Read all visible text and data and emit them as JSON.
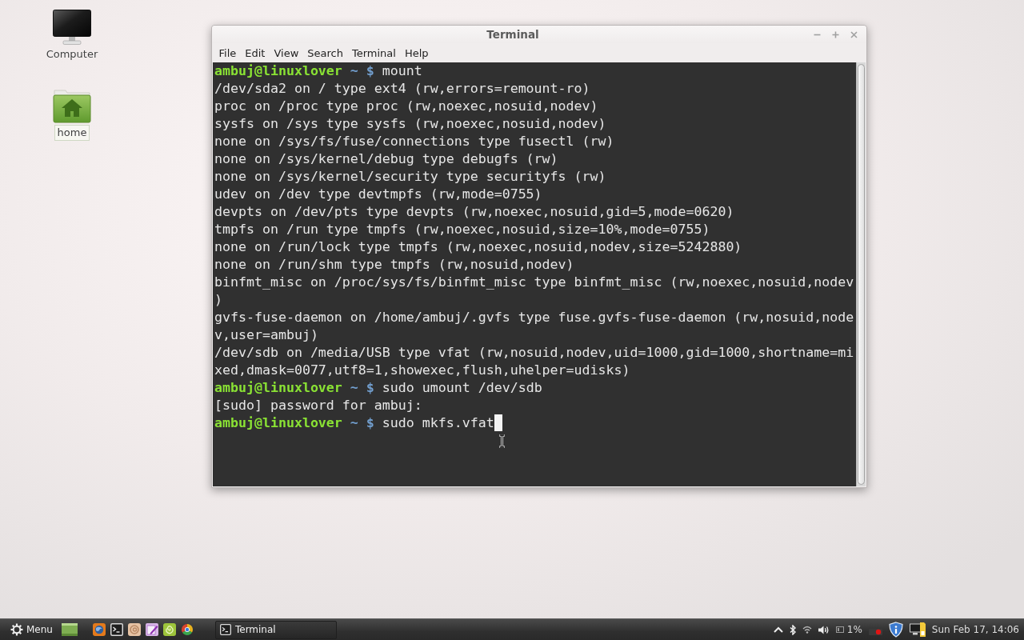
{
  "desktop_icons": [
    {
      "kind": "computer",
      "label": "Computer",
      "focused": false
    },
    {
      "kind": "home",
      "label": "home",
      "focused": true
    }
  ],
  "window": {
    "title": "Terminal",
    "menu": [
      "File",
      "Edit",
      "View",
      "Search",
      "Terminal",
      "Help"
    ],
    "lines": [
      {
        "kind": "prompt",
        "user_host": "ambuj@linuxlover",
        "directory": "~",
        "symbol": "$",
        "command": "mount",
        "cursor": false
      },
      {
        "kind": "output",
        "text": "/dev/sda2 on / type ext4 (rw,errors=remount-ro)",
        "cursor": false
      },
      {
        "kind": "output",
        "text": "proc on /proc type proc (rw,noexec,nosuid,nodev)",
        "cursor": false
      },
      {
        "kind": "output",
        "text": "sysfs on /sys type sysfs (rw,noexec,nosuid,nodev)",
        "cursor": false
      },
      {
        "kind": "output",
        "text": "none on /sys/fs/fuse/connections type fusectl (rw)",
        "cursor": false
      },
      {
        "kind": "output",
        "text": "none on /sys/kernel/debug type debugfs (rw)",
        "cursor": false
      },
      {
        "kind": "output",
        "text": "none on /sys/kernel/security type securityfs (rw)",
        "cursor": false
      },
      {
        "kind": "output",
        "text": "udev on /dev type devtmpfs (rw,mode=0755)",
        "cursor": false
      },
      {
        "kind": "output",
        "text": "devpts on /dev/pts type devpts (rw,noexec,nosuid,gid=5,mode=0620)",
        "cursor": false
      },
      {
        "kind": "output",
        "text": "tmpfs on /run type tmpfs (rw,noexec,nosuid,size=10%,mode=0755)",
        "cursor": false
      },
      {
        "kind": "output",
        "text": "none on /run/lock type tmpfs (rw,noexec,nosuid,nodev,size=5242880)",
        "cursor": false
      },
      {
        "kind": "output",
        "text": "none on /run/shm type tmpfs (rw,nosuid,nodev)",
        "cursor": false
      },
      {
        "kind": "output",
        "text": "binfmt_misc on /proc/sys/fs/binfmt_misc type binfmt_misc (rw,noexec,nosuid,nodev",
        "cursor": false
      },
      {
        "kind": "output",
        "text": ")",
        "cursor": false
      },
      {
        "kind": "output",
        "text": "gvfs-fuse-daemon on /home/ambuj/.gvfs type fuse.gvfs-fuse-daemon (rw,nosuid,node",
        "cursor": false
      },
      {
        "kind": "output",
        "text": "v,user=ambuj)",
        "cursor": false
      },
      {
        "kind": "output",
        "text": "/dev/sdb on /media/USB type vfat (rw,nosuid,nodev,uid=1000,gid=1000,shortname=mi",
        "cursor": false
      },
      {
        "kind": "output",
        "text": "xed,dmask=0077,utf8=1,showexec,flush,uhelper=udisks)",
        "cursor": false
      },
      {
        "kind": "prompt",
        "user_host": "ambuj@linuxlover",
        "directory": "~",
        "symbol": "$",
        "command": "sudo umount /dev/sdb",
        "cursor": false
      },
      {
        "kind": "output",
        "text": "[sudo] password for ambuj:",
        "cursor": false
      },
      {
        "kind": "prompt",
        "user_host": "ambuj@linuxlover",
        "directory": "~",
        "symbol": "$",
        "command": "sudo mkfs.vfat",
        "cursor": true
      }
    ]
  },
  "taskbar": {
    "menu_label": "Menu",
    "windows": [
      {
        "title": "Terminal"
      }
    ],
    "battery": "1%",
    "clock": "Sun Feb 17, 14:06"
  }
}
